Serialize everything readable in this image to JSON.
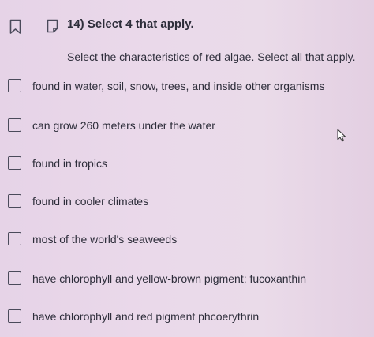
{
  "question": {
    "title": "14) Select 4 that apply.",
    "instruction": "Select the characteristics of red algae. Select all that apply."
  },
  "options": [
    {
      "label": "found in water, soil, snow, trees, and inside other organisms",
      "checked": false
    },
    {
      "label": "can grow 260 meters under the water",
      "checked": false
    },
    {
      "label": "found in tropics",
      "checked": false
    },
    {
      "label": "found in cooler climates",
      "checked": false
    },
    {
      "label": "most of the world's seaweeds",
      "checked": false
    },
    {
      "label": "have chlorophyll and yellow-brown pigment: fucoxanthin",
      "checked": false
    },
    {
      "label": "have chlorophyll and red pigment phcoerythrin",
      "checked": false
    }
  ],
  "icons": {
    "bookmark": "bookmark-icon",
    "note": "note-icon",
    "cursor": "mouse-pointer-icon"
  }
}
